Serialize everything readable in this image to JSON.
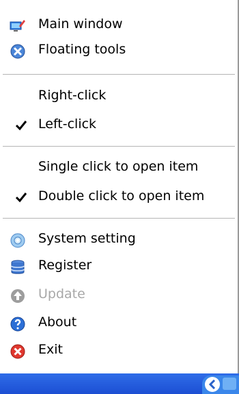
{
  "menu": {
    "main_window": "Main window",
    "floating_tools": "Floating tools",
    "right_click": "Right-click",
    "left_click": "Left-click",
    "single_click": "Single click to open item",
    "double_click": "Double click to open item",
    "system_setting": "System setting",
    "register": "Register",
    "update": "Update",
    "about": "About",
    "exit": "Exit"
  },
  "icons": {
    "main_window": "monitor-pencil-icon",
    "floating_tools": "floating-tools-icon",
    "system_setting": "settings-disc-icon",
    "register": "database-icon",
    "update": "update-arrow-icon",
    "about": "help-icon",
    "exit": "exit-icon"
  },
  "checked": {
    "left_click": true,
    "double_click": true
  },
  "colors": {
    "taskbar": "#2458de",
    "disabled_text": "#a8a8a8"
  }
}
